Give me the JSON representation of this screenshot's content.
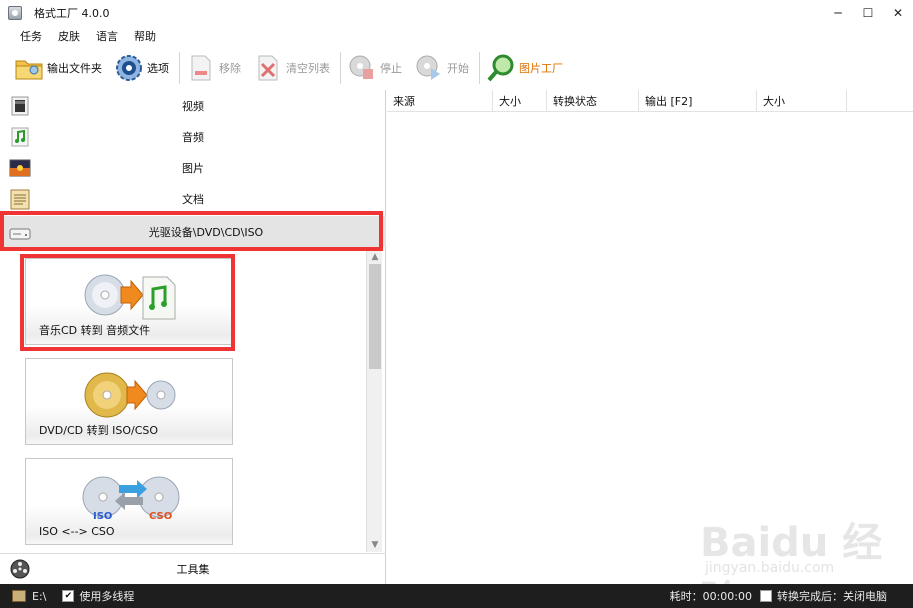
{
  "window": {
    "title": "格式工厂 4.0.0",
    "minimize": "─",
    "maximize": "☐",
    "close": "✕"
  },
  "menu": [
    "任务",
    "皮肤",
    "语言",
    "帮助"
  ],
  "toolbar": {
    "output_folder": "输出文件夹",
    "options": "选项",
    "remove": "移除",
    "clear_list": "清空列表",
    "stop": "停止",
    "start": "开始",
    "picture_factory": "图片工厂"
  },
  "categories": {
    "video": "视频",
    "audio": "音频",
    "picture": "图片",
    "document": "文档",
    "optical": "光驱设备\\DVD\\CD\\ISO",
    "tools": "工具集"
  },
  "tiles": [
    {
      "label": "音乐CD 转到 音频文件"
    },
    {
      "label": "DVD/CD 转到 ISO/CSO"
    },
    {
      "label": "ISO <--> CSO"
    }
  ],
  "tile_badges": {
    "iso": "ISO",
    "cso": "CSO"
  },
  "table": {
    "columns": [
      "来源",
      "大小",
      "转换状态",
      "输出 [F2]",
      "大小"
    ]
  },
  "status": {
    "drive": "E:\\",
    "multithread": "使用多线程",
    "elapsed": "耗时：00:00:00",
    "after_done": "转换完成后：关闭电脑"
  },
  "colors": {
    "highlight": "#f03434",
    "accent": "#e07000"
  }
}
